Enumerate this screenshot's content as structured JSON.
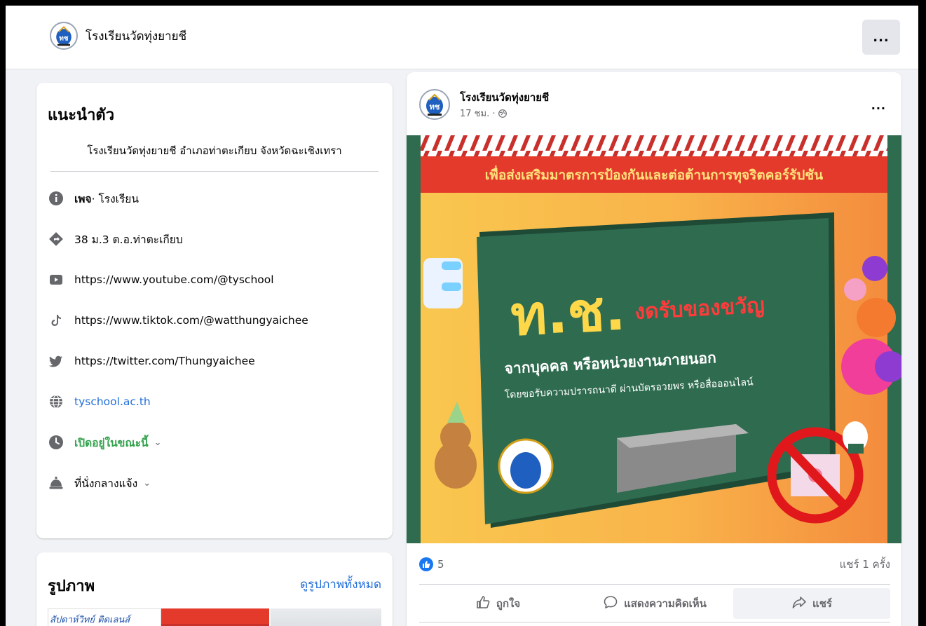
{
  "header": {
    "page_name": "โรงเรียนวัดทุ่งยายชี",
    "more_label": "..."
  },
  "intro": {
    "title": "แนะนำตัว",
    "bio": "โรงเรียนวัดทุ่งยายชี อำเภอท่าตะเกียบ จังหวัดฉะเชิงเทรา",
    "items": [
      {
        "icon": "info-icon",
        "prefix": "เพจ",
        "text": " · โรงเรียน"
      },
      {
        "icon": "location-icon",
        "text": "38 ม.3 ต.อ.ท่าตะเกียบ"
      },
      {
        "icon": "youtube-icon",
        "text": "https://www.youtube.com/@tyschool"
      },
      {
        "icon": "tiktok-icon",
        "text": "https://www.tiktok.com/@watthungyaichee"
      },
      {
        "icon": "twitter-icon",
        "text": "https://twitter.com/Thungyaichee"
      },
      {
        "icon": "globe-icon",
        "text": "tyschool.ac.th"
      },
      {
        "icon": "clock-icon",
        "text": "เปิดอยู่ในขณะนี้"
      },
      {
        "icon": "service-bell-icon",
        "text": "ที่นั่งกลางแจ้ง"
      }
    ]
  },
  "photos": {
    "title": "รูปภาพ",
    "see_all": "ดูรูปภาพทั้งหมด",
    "thumb1_text": "สัปดาห์วิทย์ ติดเลนส์"
  },
  "post": {
    "author": "โรงเรียนวัดทุ่งยายชี",
    "time": "17 ชม. · ",
    "more_label": "...",
    "image": {
      "banner": "เพื่อส่งเสริมมาตรการป้องกันและต่อต้านการทุจริตคอร์รัปชัน",
      "headline_big": "ท.ช.",
      "headline_red": "งดรับของขวัญ",
      "subhead": "จากบุคคล หรือหน่วยงานภายนอก",
      "detail": "โดยขอรับความปรารถนาดี ผ่านบัตรอวยพร หรือสื่อออนไลน์"
    },
    "likes": "5",
    "shares": "แชร์ 1 ครั้ง",
    "actions": {
      "like": "ถูกใจ",
      "comment": "แสดงความคิดเห็น",
      "share": "แชร์"
    }
  },
  "colors": {
    "accent": "#1877f2",
    "link": "#216fdb",
    "open_green": "#31a24c",
    "board_green": "#2f6b4f",
    "banner_red": "#e43a2c"
  }
}
